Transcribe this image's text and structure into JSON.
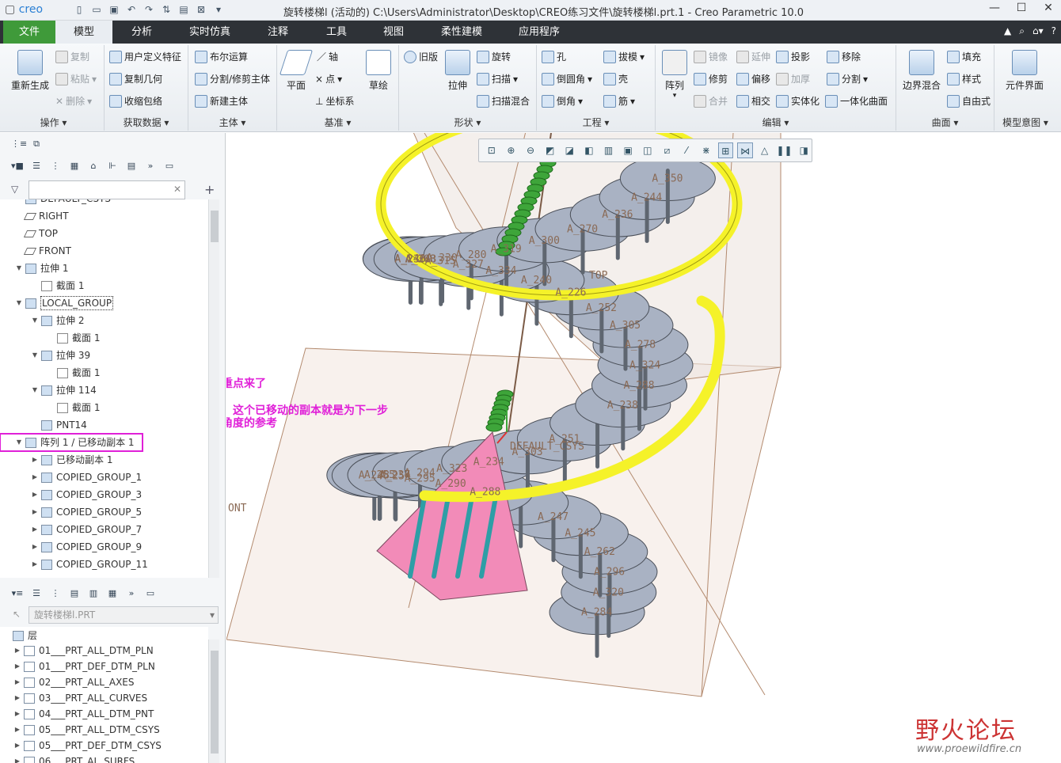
{
  "window": {
    "logo": "creo",
    "title": "旋转楼梯l (活动的) C:\\Users\\Administrator\\Desktop\\CREO练习文件\\旋转楼梯l.prt.1 - Creo Parametric 10.0"
  },
  "tabs": [
    "文件",
    "模型",
    "分析",
    "实时仿真",
    "注释",
    "工具",
    "视图",
    "柔性建模",
    "应用程序"
  ],
  "ribbon": {
    "ops": {
      "big": "重新生成",
      "items": [
        "复制",
        "粘贴",
        "删除"
      ],
      "group": "操作"
    },
    "getdata": {
      "items": [
        "用户定义特征",
        "复制几何",
        "收缩包络"
      ],
      "group": "获取数据"
    },
    "body": {
      "items": [
        "布尔运算",
        "分割/修剪主体",
        "新建主体"
      ],
      "group": "主体"
    },
    "datum": {
      "big1": "平面",
      "items": [
        "轴",
        "点",
        "坐标系"
      ],
      "big2": "草绘",
      "group": "基准"
    },
    "shape": {
      "old": "旧版",
      "big": "拉伸",
      "items": [
        "旋转",
        "扫描",
        "扫描混合"
      ],
      "group": "形状"
    },
    "eng": {
      "items": [
        "孔",
        "倒圆角",
        "倒角",
        "拔模",
        "壳",
        "筋"
      ],
      "group": "工程"
    },
    "edit": {
      "big": "阵列",
      "items": [
        "镜像",
        "延伸",
        "投影",
        "修剪",
        "偏移",
        "加厚",
        "合并",
        "相交",
        "实体化",
        "移除",
        "分割",
        "一体化曲面"
      ],
      "group": "编辑"
    },
    "surface": {
      "big": "边界混合",
      "items": [
        "填充",
        "样式",
        "自由式"
      ],
      "group": "曲面"
    },
    "intent": {
      "big": "元件界面",
      "group": "模型意图"
    }
  },
  "tree": [
    {
      "label": "DEFAULT_CSYS",
      "indent": 0,
      "icon": "csys"
    },
    {
      "label": "RIGHT",
      "indent": 0,
      "icon": "plane"
    },
    {
      "label": "TOP",
      "indent": 0,
      "icon": "plane"
    },
    {
      "label": "FRONT",
      "indent": 0,
      "icon": "plane"
    },
    {
      "label": "拉伸 1",
      "indent": 0,
      "icon": "extrude",
      "expand": "▼"
    },
    {
      "label": "截面 1",
      "indent": 1,
      "icon": "sect"
    },
    {
      "label": "LOCAL_GROUP",
      "indent": 0,
      "icon": "group",
      "expand": "▼"
    },
    {
      "label": "拉伸 2",
      "indent": 1,
      "icon": "extrude",
      "expand": "▼"
    },
    {
      "label": "截面 1",
      "indent": 2,
      "icon": "sect"
    },
    {
      "label": "拉伸 39",
      "indent": 1,
      "icon": "extrude",
      "expand": "▼"
    },
    {
      "label": "截面 1",
      "indent": 2,
      "icon": "sect"
    },
    {
      "label": "拉伸 114",
      "indent": 1,
      "icon": "extrude",
      "expand": "▼"
    },
    {
      "label": "截面 1",
      "indent": 2,
      "icon": "sect"
    },
    {
      "label": "PNT14",
      "indent": 1,
      "icon": "pnt"
    },
    {
      "label": "阵列 1 / 已移动副本 1",
      "indent": 0,
      "icon": "pattern",
      "expand": "▼"
    },
    {
      "label": "已移动副本 1",
      "indent": 1,
      "icon": "copy",
      "expand": "▶"
    },
    {
      "label": "COPIED_GROUP_1",
      "indent": 1,
      "icon": "copy",
      "expand": "▶"
    },
    {
      "label": "COPIED_GROUP_3",
      "indent": 1,
      "icon": "copy",
      "expand": "▶"
    },
    {
      "label": "COPIED_GROUP_5",
      "indent": 1,
      "icon": "copy",
      "expand": "▶"
    },
    {
      "label": "COPIED_GROUP_7",
      "indent": 1,
      "icon": "copy",
      "expand": "▶"
    },
    {
      "label": "COPIED_GROUP_9",
      "indent": 1,
      "icon": "copy",
      "expand": "▶"
    },
    {
      "label": "COPIED_GROUP_11",
      "indent": 1,
      "icon": "copy",
      "expand": "▶"
    }
  ],
  "layer_panel": {
    "combo": "旋转楼梯l.PRT",
    "root": "层",
    "layers": [
      "01___PRT_ALL_DTM_PLN",
      "01___PRT_DEF_DTM_PLN",
      "02___PRT_ALL_AXES",
      "03___PRT_ALL_CURVES",
      "04___PRT_ALL_DTM_PNT",
      "05___PRT_ALL_DTM_CSYS",
      "05___PRT_DEF_DTM_CSYS",
      "06___PRT_AL_SURFS"
    ]
  },
  "annotation": {
    "line1": "经过摸索和分析，重点来了",
    "line2": "右键选择取消阵列，这个已移动的副本就是为下一步",
    "line3": "的阵列提供方向和角度的参考"
  },
  "model_labels": [
    "A_350",
    "A_330",
    "A_334",
    "A_288",
    "A_294",
    "A_290",
    "A_320",
    "A_319",
    "A_315",
    "A_278",
    "A_234",
    "A_254",
    "A_262",
    "A_270",
    "A_246",
    "A_252",
    "A_251",
    "A_248",
    "A_247",
    "A_244",
    "A_243",
    "A_240",
    "A_238",
    "A_237",
    "A_288",
    "A_284",
    "A_280",
    "A_327",
    "A_324",
    "A_323",
    "A_295",
    "A_296",
    "A_300",
    "A_308",
    "A_305",
    "A_303",
    "A_255",
    "A_245",
    "A_236",
    "A_230",
    "A_226"
  ],
  "datum_labels": {
    "top": "TOP",
    "front": "ONT",
    "csys": "DEFAULT_CSYS"
  },
  "watermark": {
    "text": "野火论坛",
    "url": "www.proewildfire.cn"
  },
  "colors": {
    "ribbon_dark": "#2e3237",
    "file_tab": "#3f9a3a",
    "annotation": "#e020d8",
    "rail": "#f5f229",
    "step": "#a9b2c3",
    "first_step": "#f28bb8"
  }
}
